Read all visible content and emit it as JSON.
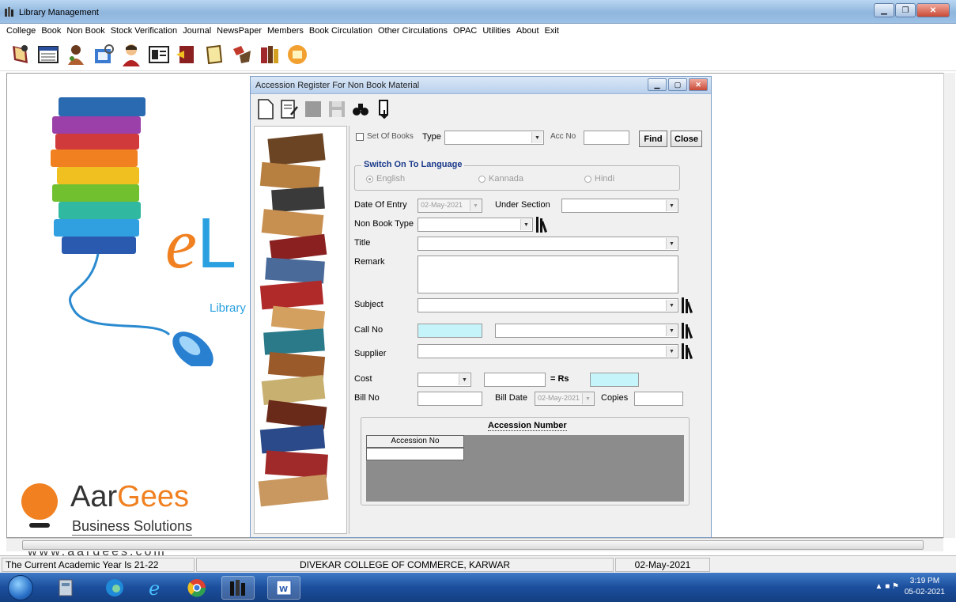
{
  "app": {
    "title": "Library Management"
  },
  "menu": [
    "College",
    "Book",
    "Non Book",
    "Stock Verification",
    "Journal",
    "NewsPaper",
    "Members",
    "Book Circulation",
    "Other Circulations",
    "OPAC",
    "Utilities",
    "About",
    "Exit"
  ],
  "logo": {
    "e": "e",
    "L": "L",
    "library": "Library",
    "brand_a": "Aar",
    "brand_b": "Gees",
    "business": "Business Solutions",
    "url": "www.aargees.com"
  },
  "child": {
    "title": "Accession Register For Non Book Material",
    "set_of_books": "Set Of Books",
    "type_label": "Type",
    "type_value": "",
    "acc_no_label": "Acc No",
    "acc_no_value": "",
    "find": "Find",
    "close": "Close",
    "language_group": "Switch On To Language",
    "lang_english": "English",
    "lang_kannada": "Kannada",
    "lang_hindi": "Hindi",
    "date_of_entry_label": "Date Of Entry",
    "date_of_entry_value": "02-May-2021",
    "under_section_label": "Under Section",
    "under_section_value": "",
    "non_book_type_label": "Non Book Type",
    "non_book_type_value": "",
    "title_label": "Title",
    "title_value": "",
    "remark_label": "Remark",
    "remark_value": "",
    "subject_label": "Subject",
    "subject_value": "",
    "call_no_label": "Call No",
    "call_no_value": "",
    "call_no_value2": "",
    "supplier_label": "Supplier",
    "supplier_value": "",
    "cost_label": "Cost",
    "cost_currency": "",
    "cost_amount": "",
    "rs_label": "= Rs",
    "rs_value": "",
    "bill_no_label": "Bill No",
    "bill_no_value": "",
    "bill_date_label": "Bill Date",
    "bill_date_value": "02-May-2021",
    "copies_label": "Copies",
    "copies_value": "",
    "accession_number_title": "Accession Number",
    "accession_col": "Accession No"
  },
  "status": {
    "academic_year": "The Current Academic Year Is 21-22",
    "college": "DIVEKAR COLLEGE OF COMMERCE, KARWAR",
    "date": "02-May-2021"
  },
  "taskbar": {
    "time": "3:19 PM",
    "date": "05-02-2021"
  },
  "colors": {
    "accent_orange": "#f08020",
    "accent_blue": "#2aa0e0",
    "cyan_field": "#c6f4fb",
    "taskbar": "#1b4e9c"
  }
}
